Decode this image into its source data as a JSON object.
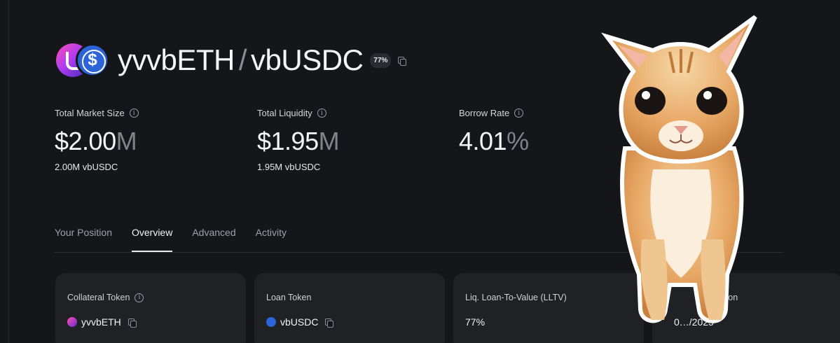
{
  "market": {
    "collateral": "yvvbETH",
    "separator": "/",
    "loan": "vbUSDC",
    "lltv_badge": "77%"
  },
  "stats": [
    {
      "label": "Total Market Size",
      "value": "$2.00",
      "unit": "M",
      "sub": "2.00M vbUSDC"
    },
    {
      "label": "Total Liquidity",
      "value": "$1.95",
      "unit": "M",
      "sub": "1.95M vbUSDC"
    },
    {
      "label": "Borrow Rate",
      "value": "4.01",
      "unit": "%"
    }
  ],
  "tabs": [
    "Your Position",
    "Overview",
    "Advanced",
    "Activity"
  ],
  "active_tab": "Overview",
  "cards": [
    {
      "label": "Collateral Token",
      "value": "yvvbETH"
    },
    {
      "label": "Loan Token",
      "value": "vbUSDC"
    },
    {
      "label": "Liq. Loan-To-Value (LLTV)",
      "value": "77%"
    },
    {
      "label": "…ion",
      "value": "0…/2025"
    }
  ],
  "info_glyph": "i",
  "colors": {
    "background": "#151619",
    "card": "#1f2125",
    "accent_blue": "#2c63d9",
    "accent_pink": "#ff4fb0"
  },
  "icons": [
    "info-icon",
    "copy-icon",
    "yvvbeth-token-icon",
    "vbusdc-token-icon"
  ]
}
